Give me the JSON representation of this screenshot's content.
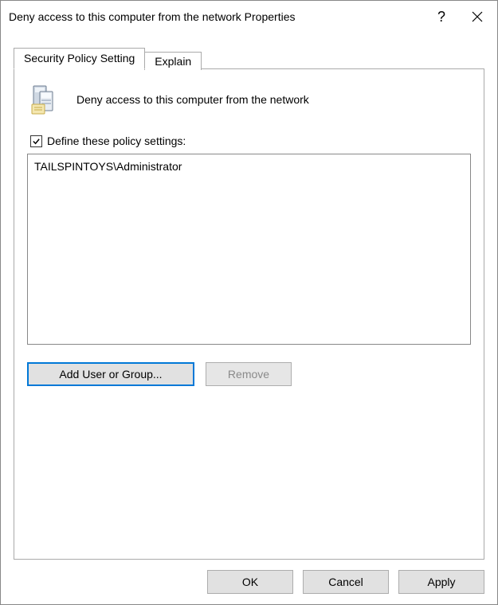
{
  "window": {
    "title": "Deny access to this computer from the network Properties"
  },
  "tabs": {
    "security": "Security Policy Setting",
    "explain": "Explain"
  },
  "policy": {
    "title": "Deny access to this computer from the network",
    "checkbox_label": "Define these policy settings:",
    "checked": true,
    "list": [
      "TAILSPINTOYS\\Administrator"
    ]
  },
  "panel_buttons": {
    "add": "Add User or Group...",
    "remove": "Remove"
  },
  "dialog_buttons": {
    "ok": "OK",
    "cancel": "Cancel",
    "apply": "Apply"
  }
}
